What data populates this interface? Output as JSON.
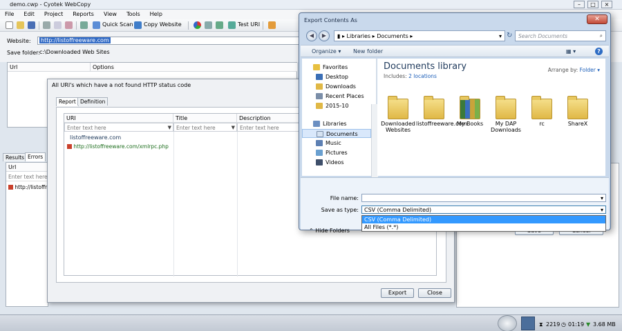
{
  "app": {
    "title": "demo.cwp - Cyotek WebCopy",
    "menu": [
      "File",
      "Edit",
      "Project",
      "Reports",
      "View",
      "Tools",
      "Help"
    ],
    "toolbar": {
      "quick_scan": "Quick Scan",
      "copy_website": "Copy Website",
      "test_uri": "Test URI"
    },
    "website_label": "Website:",
    "website_value": "http://listoffreeware.com",
    "save_folder_label": "Save folder:",
    "save_folder_value": "c:\\Downloaded Web Sites",
    "url_panel": {
      "col_url": "Url",
      "col_options": "Options"
    },
    "left_tabs": [
      "Results",
      "Errors"
    ],
    "errors_panel": {
      "col_url": "Url",
      "filter_placeholder": "Enter text here",
      "row": "http://listoffre"
    }
  },
  "not_found_dialog": {
    "title": "All URI's which have a not found HTTP status code",
    "tabs": [
      "Report",
      "Definition"
    ],
    "columns": [
      "URI",
      "Title",
      "Description"
    ],
    "filter_placeholder": "Enter text here",
    "group": "listoffreeware.com",
    "rows": [
      "http://listoffreeware.com/xmlrpc.php"
    ],
    "export_label": "Export",
    "close_label": "Close"
  },
  "export_dialog": {
    "title": "Export Contents As",
    "path": [
      "Libraries",
      "Documents"
    ],
    "search_placeholder": "Search Documents",
    "organize": "Organize",
    "new_folder": "New folder",
    "nav": {
      "favorites": "Favorites",
      "favorite_items": [
        "Desktop",
        "Downloads",
        "Recent Places",
        "2015-10"
      ],
      "libraries": "Libraries",
      "library_items": [
        "Documents",
        "Music",
        "Pictures",
        "Videos"
      ]
    },
    "library_title": "Documents library",
    "includes_label": "Includes:",
    "includes_link": "2 locations",
    "arrange_by_label": "Arrange by:",
    "arrange_by_value": "Folder",
    "folders": [
      "Downloaded Websites",
      "listoffreeware.com",
      "My Books",
      "My DAP Downloads",
      "rc",
      "ShareX"
    ],
    "file_name_label": "File name:",
    "file_name_value": "",
    "save_as_type_label": "Save as type:",
    "save_as_type_value": "CSV (Comma Delimited)",
    "type_options": [
      "CSV (Comma Delimited)",
      "All Files (*.*)"
    ],
    "save_label": "Save",
    "cancel_label": "Cancel",
    "hide_folders": "Hide Folders"
  },
  "statusbar": {
    "count": "2219",
    "time": "01:19",
    "size": "3.68 MB"
  }
}
